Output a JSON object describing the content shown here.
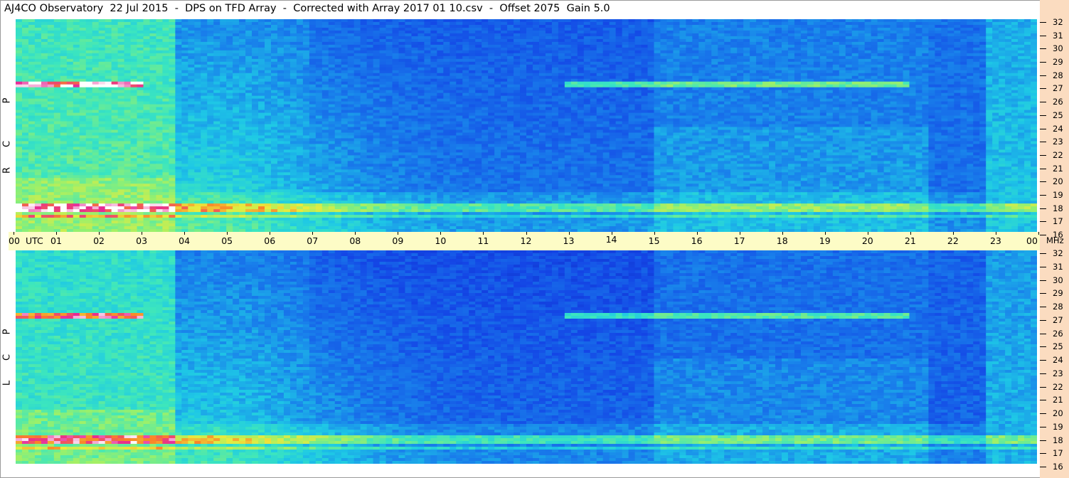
{
  "title": "AJ4CO Observatory  22 Jul 2015  -  DPS on TFD Array  -  Corrected with Array 2017 01 10.csv  -  Offset 2075  Gain 5.0",
  "axis": {
    "utc_label": "UTC",
    "mhz_label": "MHz",
    "hours": [
      "00",
      "01",
      "02",
      "03",
      "04",
      "05",
      "06",
      "07",
      "08",
      "09",
      "10",
      "11",
      "12",
      "13",
      "14",
      "15",
      "16",
      "17",
      "18",
      "19",
      "20",
      "21",
      "22",
      "23",
      "00"
    ]
  },
  "panels": [
    {
      "id": "rcp",
      "label_letters": [
        "R",
        "C",
        "P"
      ]
    },
    {
      "id": "lcp",
      "label_letters": [
        "L",
        "C",
        "P"
      ]
    }
  ],
  "colors": {
    "right_strip": "#fbdcc0",
    "axis_bar": "#fdfcc6",
    "spectrogram_low": "#0a2fc2",
    "spectrogram_high": "#ffffff"
  },
  "chart_data": {
    "type": "heatmap",
    "title": "AJ4CO Observatory  22 Jul 2015  -  DPS on TFD Array  -  Corrected with Array 2017 01 10.csv  -  Offset 2075  Gain 5.0",
    "xlabel": "UTC",
    "ylabel": "MHz",
    "xlim": [
      0,
      24
    ],
    "ylim": [
      16,
      32
    ],
    "x_ticks": [
      "00",
      "01",
      "02",
      "03",
      "04",
      "05",
      "06",
      "07",
      "08",
      "09",
      "10",
      "11",
      "12",
      "13",
      "14",
      "15",
      "16",
      "17",
      "18",
      "19",
      "20",
      "21",
      "22",
      "23",
      "00"
    ],
    "y_ticks": [
      32,
      31,
      30,
      29,
      28,
      27,
      26,
      25,
      24,
      23,
      22,
      21,
      20,
      19,
      18,
      17,
      16
    ],
    "panels": [
      "RCP",
      "LCP"
    ]
  }
}
